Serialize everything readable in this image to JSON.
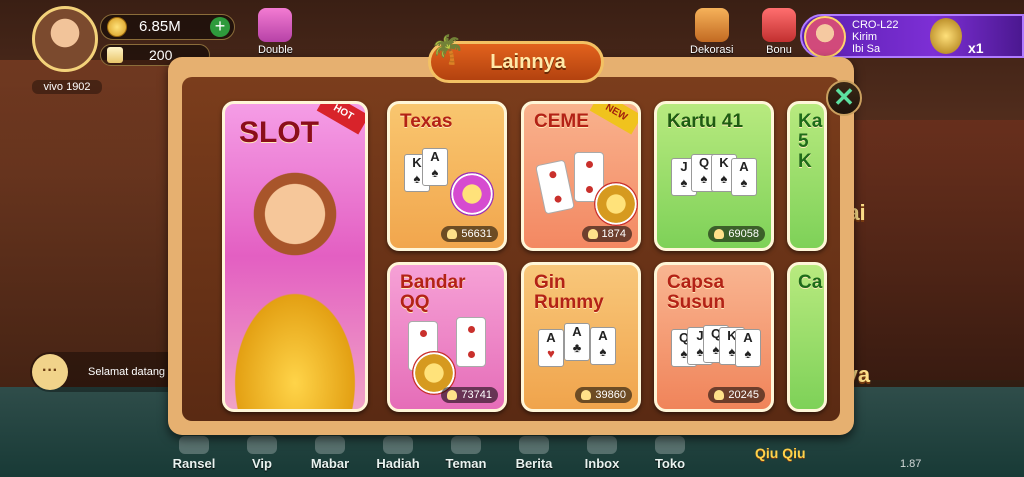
{
  "player": {
    "name": "vivo 1902",
    "coins": "6.85M",
    "gems": "200"
  },
  "top_icons": {
    "double": "Double",
    "dekorasi": "Dekorasi",
    "bonus": "Bonu"
  },
  "notification": {
    "line1": "CRO-L22",
    "line2": "Kirim",
    "line3": "Ibi Sa",
    "multiplier": "x1"
  },
  "chat": {
    "message": "Selamat datang Dor",
    "icon_glyph": "···"
  },
  "background_text": {
    "right1": "tai",
    "right2": "anya"
  },
  "modal": {
    "title": "Lainnya",
    "close_glyph": "✕",
    "cards": [
      {
        "id": "slot",
        "label": "SLOT",
        "badge": "HOT"
      },
      {
        "id": "texas",
        "label": "Texas",
        "players": "56631"
      },
      {
        "id": "ceme",
        "label": "CEME",
        "badge": "NEW",
        "players": "1874"
      },
      {
        "id": "kartu41",
        "label": "Kartu 41",
        "players": "69058"
      },
      {
        "id": "kartu5",
        "label": "Ka\n5 K"
      },
      {
        "id": "bandar",
        "label": "Bandar\nQQ",
        "players": "73741"
      },
      {
        "id": "gin",
        "label": "Gin\nRummy",
        "players": "39860"
      },
      {
        "id": "capsa",
        "label": "Capsa\nSusun",
        "players": "20245"
      },
      {
        "id": "cap2",
        "label": "Ca"
      }
    ]
  },
  "bottom_nav": [
    "Ransel",
    "Vip",
    "Mabar",
    "Hadiah",
    "Teman",
    "Berita",
    "Inbox",
    "Toko"
  ],
  "qiu_label": "Qiu Qiu",
  "version": "1.87",
  "colors": {
    "panel": "#e6b070",
    "title_bg": "#c94e15",
    "hot": "#d8232a",
    "new": "#f0c31d"
  }
}
